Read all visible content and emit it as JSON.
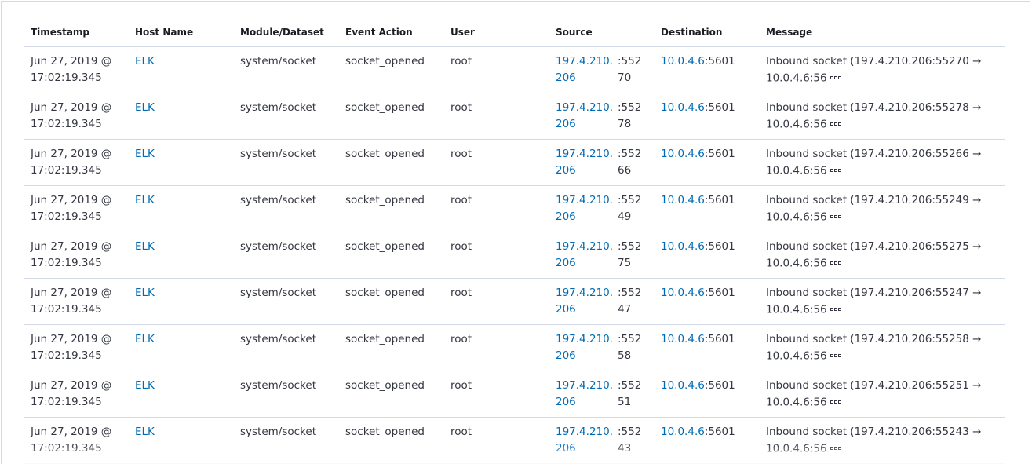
{
  "table": {
    "columns": [
      "Timestamp",
      "Host Name",
      "Module/Dataset",
      "Event Action",
      "User",
      "Source",
      "Destination",
      "Message"
    ],
    "rows": [
      {
        "ts1": "Jun 27, 2019 @",
        "ts2": "17:02:19.345",
        "host": "ELK",
        "module": "system/socket",
        "action": "socket_opened",
        "user": "root",
        "src_ip": "197.4.210.206",
        "src_port": ":55270",
        "dst_ip": "10.0.4.6",
        "dst_port": ":5601",
        "msg1": "Inbound socket (197.4.210.206:55270 →",
        "msg2": "10.0.4.6:56"
      },
      {
        "ts1": "Jun 27, 2019 @",
        "ts2": "17:02:19.345",
        "host": "ELK",
        "module": "system/socket",
        "action": "socket_opened",
        "user": "root",
        "src_ip": "197.4.210.206",
        "src_port": ":55278",
        "dst_ip": "10.0.4.6",
        "dst_port": ":5601",
        "msg1": "Inbound socket (197.4.210.206:55278 →",
        "msg2": "10.0.4.6:56"
      },
      {
        "ts1": "Jun 27, 2019 @",
        "ts2": "17:02:19.345",
        "host": "ELK",
        "module": "system/socket",
        "action": "socket_opened",
        "user": "root",
        "src_ip": "197.4.210.206",
        "src_port": ":55266",
        "dst_ip": "10.0.4.6",
        "dst_port": ":5601",
        "msg1": "Inbound socket (197.4.210.206:55266 →",
        "msg2": "10.0.4.6:56"
      },
      {
        "ts1": "Jun 27, 2019 @",
        "ts2": "17:02:19.345",
        "host": "ELK",
        "module": "system/socket",
        "action": "socket_opened",
        "user": "root",
        "src_ip": "197.4.210.206",
        "src_port": ":55249",
        "dst_ip": "10.0.4.6",
        "dst_port": ":5601",
        "msg1": "Inbound socket (197.4.210.206:55249 →",
        "msg2": "10.0.4.6:56"
      },
      {
        "ts1": "Jun 27, 2019 @",
        "ts2": "17:02:19.345",
        "host": "ELK",
        "module": "system/socket",
        "action": "socket_opened",
        "user": "root",
        "src_ip": "197.4.210.206",
        "src_port": ":55275",
        "dst_ip": "10.0.4.6",
        "dst_port": ":5601",
        "msg1": "Inbound socket (197.4.210.206:55275 →",
        "msg2": "10.0.4.6:56"
      },
      {
        "ts1": "Jun 27, 2019 @",
        "ts2": "17:02:19.345",
        "host": "ELK",
        "module": "system/socket",
        "action": "socket_opened",
        "user": "root",
        "src_ip": "197.4.210.206",
        "src_port": ":55247",
        "dst_ip": "10.0.4.6",
        "dst_port": ":5601",
        "msg1": "Inbound socket (197.4.210.206:55247 →",
        "msg2": "10.0.4.6:56"
      },
      {
        "ts1": "Jun 27, 2019 @",
        "ts2": "17:02:19.345",
        "host": "ELK",
        "module": "system/socket",
        "action": "socket_opened",
        "user": "root",
        "src_ip": "197.4.210.206",
        "src_port": ":55258",
        "dst_ip": "10.0.4.6",
        "dst_port": ":5601",
        "msg1": "Inbound socket (197.4.210.206:55258 →",
        "msg2": "10.0.4.6:56"
      },
      {
        "ts1": "Jun 27, 2019 @",
        "ts2": "17:02:19.345",
        "host": "ELK",
        "module": "system/socket",
        "action": "socket_opened",
        "user": "root",
        "src_ip": "197.4.210.206",
        "src_port": ":55251",
        "dst_ip": "10.0.4.6",
        "dst_port": ":5601",
        "msg1": "Inbound socket (197.4.210.206:55251 →",
        "msg2": "10.0.4.6:56"
      },
      {
        "ts1": "Jun 27, 2019 @",
        "ts2": "17:02:19.345",
        "host": "ELK",
        "module": "system/socket",
        "action": "socket_opened",
        "user": "root",
        "src_ip": "197.4.210.206",
        "src_port": ":55243",
        "dst_ip": "10.0.4.6",
        "dst_port": ":5601",
        "msg1": "Inbound socket (197.4.210.206:55243 →",
        "msg2": "10.0.4.6:56"
      }
    ]
  },
  "colors": {
    "link": "#006bb4",
    "text": "#343741",
    "border": "#d3dae6"
  }
}
